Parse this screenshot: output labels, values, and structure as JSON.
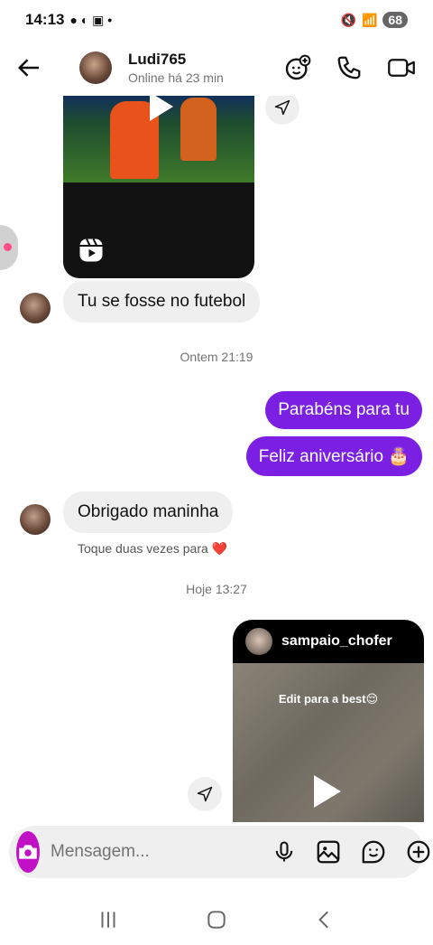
{
  "status_bar": {
    "time": "14:13",
    "battery": "68"
  },
  "header": {
    "name": "Ludi765",
    "status": "Online há 23 min"
  },
  "messages": {
    "msg1": "Tu se fosse no futebol",
    "time1": "Ontem 21:19",
    "out1": "Parabéns para tu",
    "out2": "Feliz aniversário 🎂",
    "msg2": "Obrigado maninha",
    "reply_hint": "Toque duas vezes para ❤️",
    "time2": "Hoje 13:27"
  },
  "reel_share": {
    "username": "sampaio_chofer",
    "caption": "Edit para a best😌"
  },
  "composer": {
    "placeholder": "Mensagem..."
  },
  "colors": {
    "accent_out": "#7b1fe3",
    "camera": "#c111c6"
  }
}
